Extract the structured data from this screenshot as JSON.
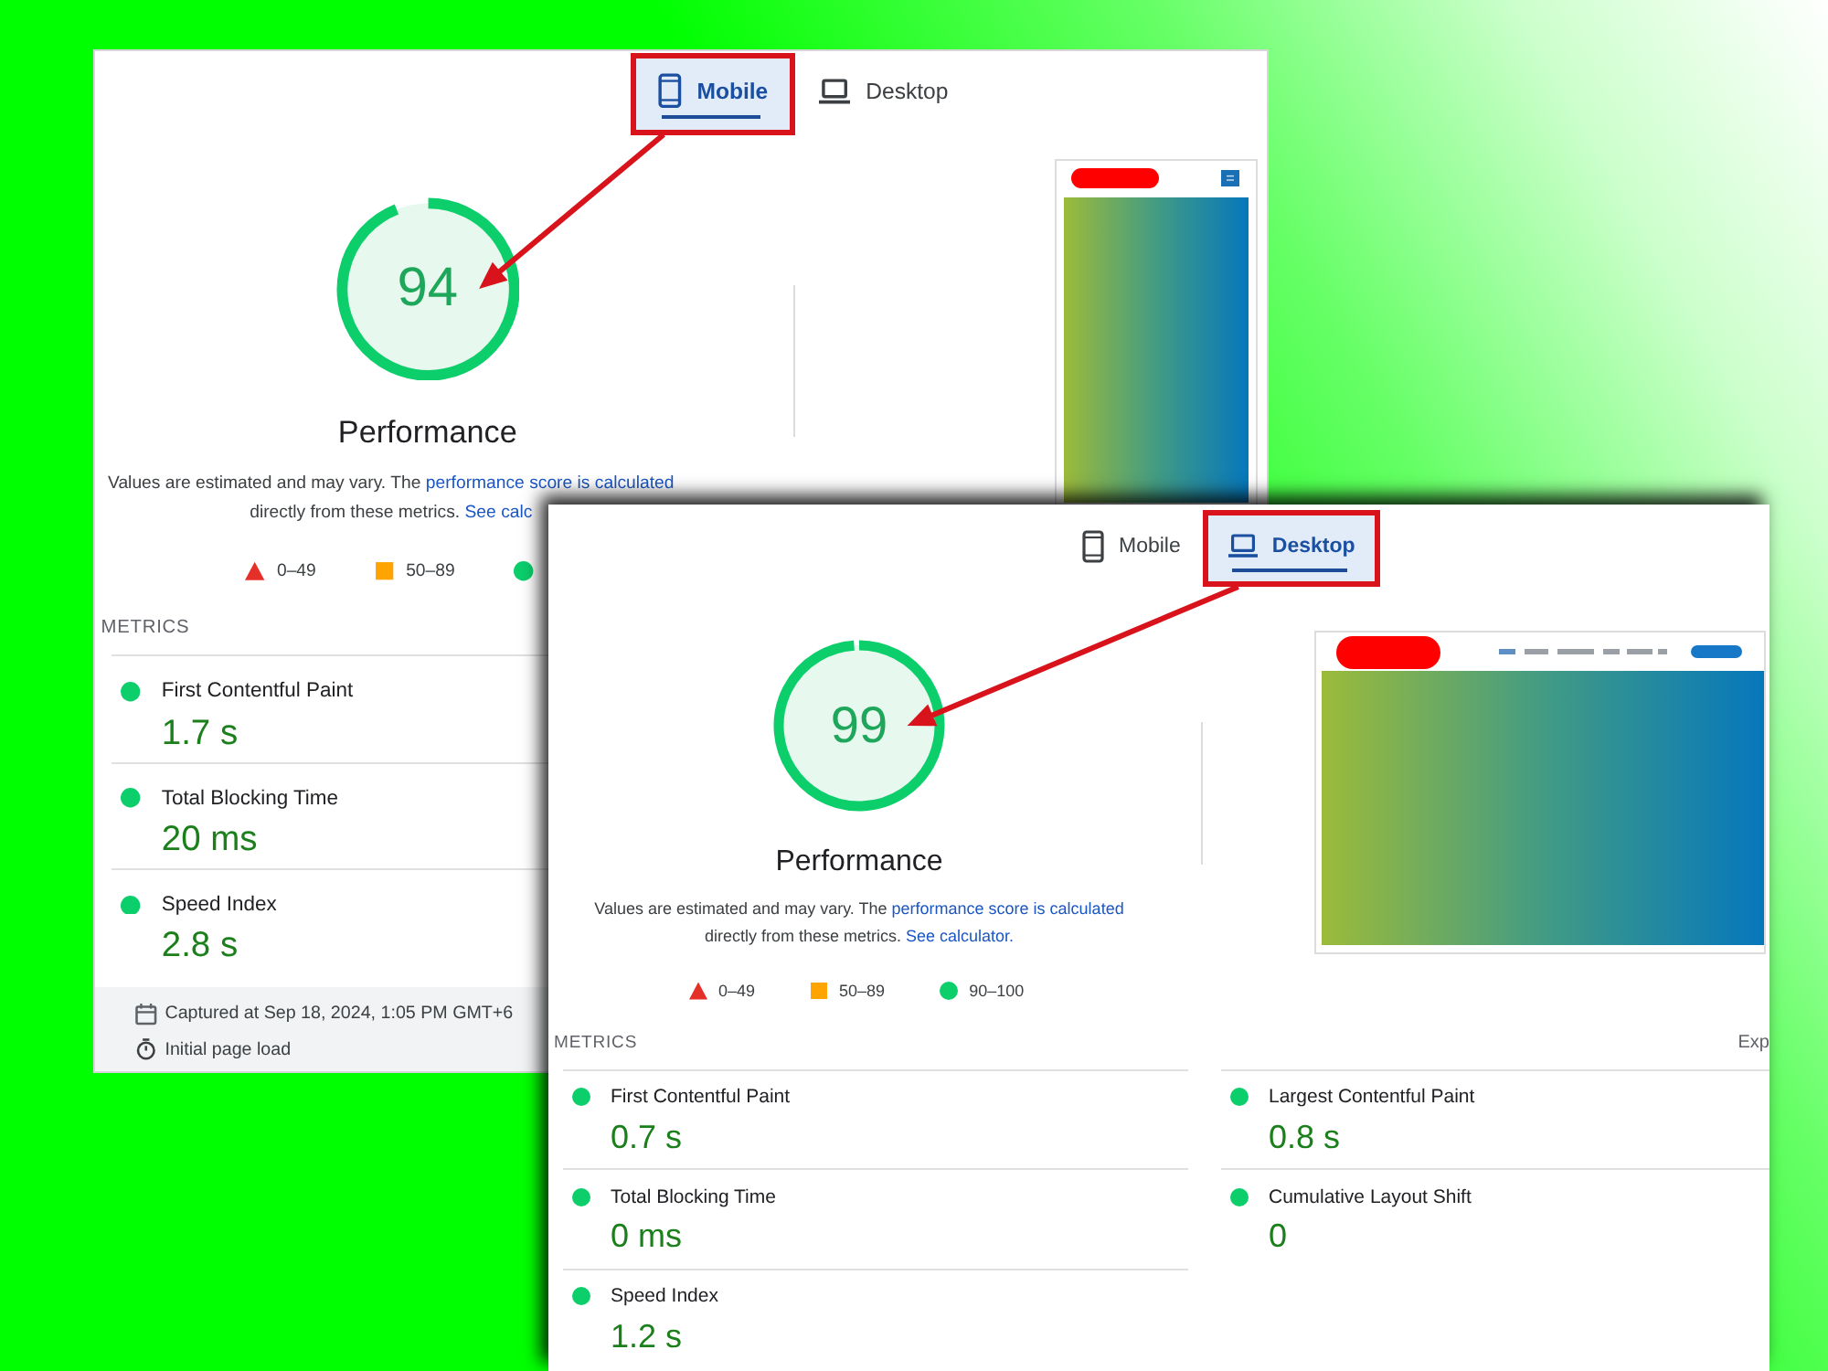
{
  "panels": [
    {
      "tabs": [
        {
          "kind": "mobile",
          "label": "Mobile",
          "selected": true,
          "highlighted": true
        },
        {
          "kind": "desktop",
          "label": "Desktop",
          "selected": false,
          "highlighted": false
        }
      ],
      "score": {
        "value": "94",
        "level": 0.94
      },
      "category": "Performance",
      "description": [
        {
          "kind": "text",
          "text": "Values are estimated and may vary. The "
        },
        {
          "kind": "link",
          "text": "performance score is calculated"
        },
        {
          "kind": "text",
          "text": " directly from these metrics. "
        },
        {
          "kind": "link",
          "text": "See calc"
        }
      ],
      "legend": [
        {
          "kind": "fail",
          "label": "0–49"
        },
        {
          "kind": "average",
          "label": "50–89"
        },
        {
          "kind": "pass"
        }
      ],
      "preview": {
        "kind": "mobile",
        "logo_redacted": true
      },
      "metrics_heading": "METRICS",
      "metrics": [
        {
          "kind": "pass",
          "label": "First Contentful Paint",
          "value": "1.7 s"
        },
        {
          "kind": "pass",
          "label": "Total Blocking Time",
          "value": "20 ms"
        },
        {
          "kind": "pass",
          "label": "Speed Index",
          "value": "2.8 s"
        }
      ],
      "footer": [
        {
          "kind": "date",
          "text": "Captured at Sep 18, 2024, 1:05 PM GMT+6"
        },
        {
          "kind": "timer",
          "text": "Initial page load"
        }
      ]
    },
    {
      "tabs": [
        {
          "kind": "mobile",
          "label": "Mobile",
          "selected": false,
          "highlighted": false
        },
        {
          "kind": "desktop",
          "label": "Desktop",
          "selected": true,
          "highlighted": true
        }
      ],
      "score": {
        "value": "99",
        "level": 0.99
      },
      "category": "Performance",
      "description": [
        {
          "kind": "text",
          "text": "Values are estimated and may vary. The "
        },
        {
          "kind": "link",
          "text": "performance score is calculated"
        },
        {
          "kind": "text",
          "text": " directly from these metrics. "
        },
        {
          "kind": "link",
          "text": "See calculator."
        }
      ],
      "legend": [
        {
          "kind": "fail",
          "label": "0–49"
        },
        {
          "kind": "average",
          "label": "50–89"
        },
        {
          "kind": "pass",
          "label": "90–100"
        }
      ],
      "preview": {
        "kind": "desktop",
        "logo_redacted": true
      },
      "metrics_heading": "METRICS",
      "metrics_toggle": "Exp",
      "metrics": [
        {
          "kind": "pass",
          "label": "First Contentful Paint",
          "value": "0.7 s"
        },
        {
          "kind": "pass",
          "label": "Largest Contentful Paint",
          "value": "0.8 s"
        },
        {
          "kind": "pass",
          "label": "Total Blocking Time",
          "value": "0 ms"
        },
        {
          "kind": "pass",
          "label": "Cumulative Layout Shift",
          "value": "0"
        },
        {
          "kind": "pass",
          "label": "Speed Index",
          "value": "1.2 s"
        }
      ]
    }
  ]
}
